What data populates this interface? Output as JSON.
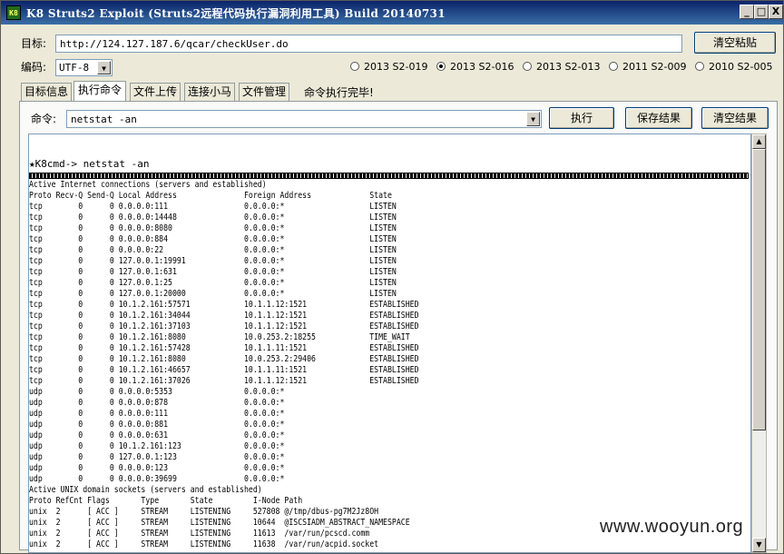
{
  "window": {
    "icon_text": "K8",
    "title": "K8 Struts2 Exploit (Struts2远程代码执行漏洞利用工具)  Build 20140731",
    "minimize": "_",
    "maximize": "□",
    "close": "X"
  },
  "target": {
    "label": "目标:",
    "url": "http://124.127.187.6/qcar/checkUser.do",
    "clear_button": "清空粘贴"
  },
  "encoding": {
    "label": "编码:",
    "value": "UTF-8"
  },
  "exploits": [
    {
      "label": "2013 S2-019",
      "selected": false
    },
    {
      "label": "2013 S2-016",
      "selected": true
    },
    {
      "label": "2013 S2-013",
      "selected": false
    },
    {
      "label": "2011 S2-009",
      "selected": false
    },
    {
      "label": "2010 S2-005",
      "selected": false
    }
  ],
  "tabs": [
    {
      "label": "目标信息",
      "active": false
    },
    {
      "label": "执行命令",
      "active": true
    },
    {
      "label": "文件上传",
      "active": false
    },
    {
      "label": "连接小马",
      "active": false
    },
    {
      "label": "文件管理",
      "active": false
    }
  ],
  "status_message": "命令执行完毕!",
  "command": {
    "label": "命令:",
    "value": "netstat -an",
    "execute_button": "执行",
    "save_button": "保存结果",
    "clear_button": "清空结果"
  },
  "output": {
    "prompt": "★K8cmd-> netstat -an",
    "lines": [
      "Active Internet connections (servers and established)",
      "Proto Recv-Q Send-Q Local Address               Foreign Address             State",
      "tcp        0      0 0.0.0.0:111                 0.0.0.0:*                   LISTEN",
      "tcp        0      0 0.0.0.0:14448               0.0.0.0:*                   LISTEN",
      "tcp        0      0 0.0.0.0:8080                0.0.0.0:*                   LISTEN",
      "tcp        0      0 0.0.0.0:884                 0.0.0.0:*                   LISTEN",
      "tcp        0      0 0.0.0.0:22                  0.0.0.0:*                   LISTEN",
      "tcp        0      0 127.0.0.1:19991             0.0.0.0:*                   LISTEN",
      "tcp        0      0 127.0.0.1:631               0.0.0.0:*                   LISTEN",
      "tcp        0      0 127.0.0.1:25                0.0.0.0:*                   LISTEN",
      "tcp        0      0 127.0.0.1:20000             0.0.0.0:*                   LISTEN",
      "tcp        0      0 10.1.2.161:57571            10.1.1.12:1521              ESTABLISHED",
      "tcp        0      0 10.1.2.161:34044            10.1.1.12:1521              ESTABLISHED",
      "tcp        0      0 10.1.2.161:37103            10.1.1.12:1521              ESTABLISHED",
      "tcp        0      0 10.1.2.161:8080             10.0.253.2:18255            TIME_WAIT",
      "tcp        0      0 10.1.2.161:57428            10.1.1.11:1521              ESTABLISHED",
      "tcp        0      0 10.1.2.161:8080             10.0.253.2:29406            ESTABLISHED",
      "tcp        0      0 10.1.2.161:46657            10.1.1.11:1521              ESTABLISHED",
      "tcp        0      0 10.1.2.161:37026            10.1.1.12:1521              ESTABLISHED",
      "udp        0      0 0.0.0.0:5353                0.0.0.0:*",
      "udp        0      0 0.0.0.0:878                 0.0.0.0:*",
      "udp        0      0 0.0.0.0:111                 0.0.0.0:*",
      "udp        0      0 0.0.0.0:881                 0.0.0.0:*",
      "udp        0      0 0.0.0.0:631                 0.0.0.0:*",
      "udp        0      0 10.1.2.161:123              0.0.0.0:*",
      "udp        0      0 127.0.0.1:123               0.0.0.0:*",
      "udp        0      0 0.0.0.0:123                 0.0.0.0:*",
      "udp        0      0 0.0.0.0:39699               0.0.0.0:*",
      "Active UNIX domain sockets (servers and established)",
      "Proto RefCnt Flags       Type       State         I-Node Path",
      "unix  2      [ ACC ]     STREAM     LISTENING     527808 @/tmp/dbus-pg7M2Jz8OH",
      "unix  2      [ ACC ]     STREAM     LISTENING     10644  @ISCSIADM_ABSTRACT_NAMESPACE",
      "unix  2      [ ACC ]     STREAM     LISTENING     11613  /var/run/pcscd.comm",
      "unix  2      [ ACC ]     STREAM     LISTENING     11638  /var/run/acpid.socket"
    ]
  },
  "scrollbar": {
    "up": "▲",
    "down": "▼"
  },
  "watermark": "www.wooyun.org"
}
